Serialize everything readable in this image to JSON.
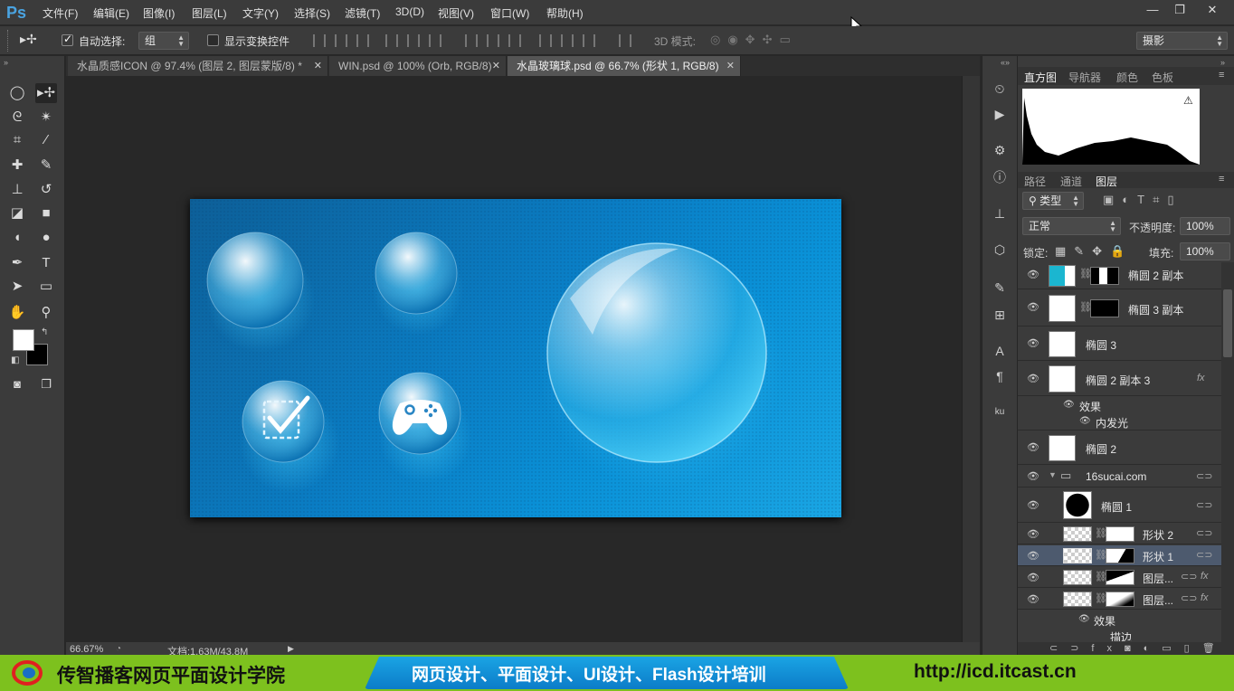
{
  "app": {
    "logo": "Ps"
  },
  "menu": [
    "文件(F)",
    "编辑(E)",
    "图像(I)",
    "图层(L)",
    "文字(Y)",
    "选择(S)",
    "滤镜(T)",
    "3D(D)",
    "视图(V)",
    "窗口(W)",
    "帮助(H)"
  ],
  "window_controls": {
    "minimize": "—",
    "restore": "❐",
    "close": "✕"
  },
  "options": {
    "auto_select_label": "自动选择:",
    "auto_select_value": "组",
    "show_transform_label": "显示变换控件",
    "mode_3d_label": "3D 模式:",
    "workspace": "摄影"
  },
  "tabs": [
    {
      "label": "水晶质感ICON @ 97.4% (图层 2, 图层蒙版/8) *",
      "active": false
    },
    {
      "label": "WIN.psd @ 100% (Orb, RGB/8)",
      "active": false
    },
    {
      "label": "水晶玻璃球.psd @ 66.7% (形状 1, RGB/8)",
      "active": true
    }
  ],
  "status": {
    "zoom": "66.67%",
    "doc": "文档:1.63M/43.8M"
  },
  "panels": {
    "top_tabs": [
      "直方图",
      "导航器",
      "颜色",
      "色板"
    ],
    "layer_tabs": [
      "路径",
      "通道",
      "图层"
    ],
    "filter_kind": "类型",
    "blend_mode": "正常",
    "opacity_label": "不透明度:",
    "opacity_value": "100%",
    "lock_label": "锁定:",
    "fill_label": "填充:",
    "fill_value": "100%",
    "warning_icon": "⚠"
  },
  "layers": [
    {
      "name": "椭圆 2 副本"
    },
    {
      "name": "椭圆 3 副本"
    },
    {
      "name": "椭圆 3"
    },
    {
      "name": "椭圆 2 副本 3",
      "fx": "fx"
    },
    {
      "name": "效果"
    },
    {
      "name": "内发光"
    },
    {
      "name": "椭圆 2"
    },
    {
      "name": "16sucai.com"
    },
    {
      "name": "椭圆 1"
    },
    {
      "name": "形状 2"
    },
    {
      "name": "形状 1",
      "selected": true
    },
    {
      "name": "图层...",
      "fx": "fx"
    },
    {
      "name": "图层...",
      "fx": "fx"
    },
    {
      "name": "效果"
    },
    {
      "name": "描边"
    }
  ],
  "banner": {
    "left": "传智播客网页平面设计学院",
    "center": "网页设计、平面设计、UI设计、Flash设计培训",
    "right": "http://icd.itcast.cn"
  },
  "colors": {
    "accent": "#4aa3e0",
    "banner_green": "#7dc11e",
    "banner_blue": "#1aa4e4",
    "canvas_blue": "#0a7dc4"
  }
}
